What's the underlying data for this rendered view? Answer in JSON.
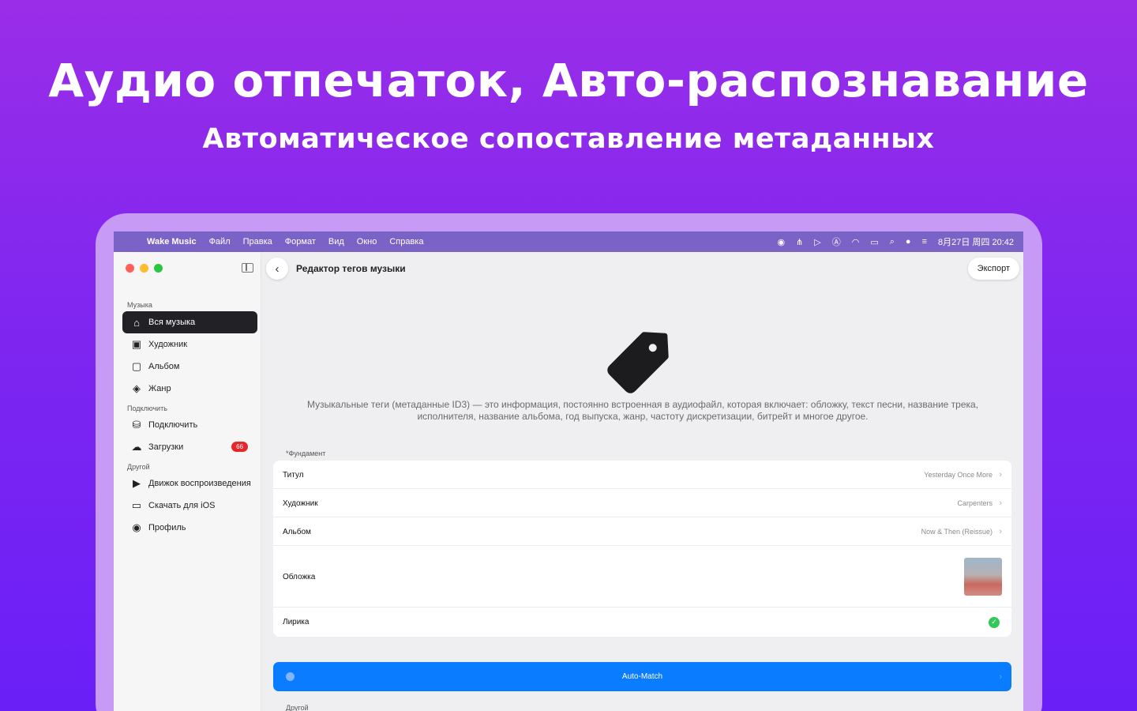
{
  "hero": {
    "title": "Аудио отпечаток, Авто-распознавание",
    "subtitle": "Автоматическое сопоставление метаданных"
  },
  "menubar": {
    "app_name": "Wake Music",
    "menus": [
      "Файл",
      "Правка",
      "Формат",
      "Вид",
      "Окно",
      "Справка"
    ],
    "clock": "8月27日 周四  20:42"
  },
  "sidebar": {
    "sections": [
      {
        "label": "Музыка"
      },
      {
        "label": "Подключить"
      },
      {
        "label": "Другой"
      }
    ],
    "items": [
      {
        "label": "Вся музыка",
        "icon": "home-music-icon",
        "active": true
      },
      {
        "label": "Художник",
        "icon": "artist-icon"
      },
      {
        "label": "Альбом",
        "icon": "album-icon"
      },
      {
        "label": "Жанр",
        "icon": "genre-layers-icon"
      },
      {
        "label": "Подключить",
        "icon": "drive-icon"
      },
      {
        "label": "Загрузки",
        "icon": "cloud-download-icon",
        "badge": "66"
      },
      {
        "label": "Движок воспроизведения",
        "icon": "play-engine-icon"
      },
      {
        "label": "Скачать для iOS",
        "icon": "devices-icon"
      },
      {
        "label": "Профиль",
        "icon": "profile-icon"
      }
    ]
  },
  "main": {
    "title": "Редактор тегов музыки",
    "export_label": "Экспорт",
    "description": "Музыкальные теги (метаданные ID3) — это информация, постоянно встроенная в аудиофайл, которая включает: обложку, текст песни, название трека, исполнителя, название альбома, год выпуска, жанр, частоту дискретизации, битрейт и многое другое.",
    "group_basic": "*Фундамент",
    "fields": [
      {
        "label": "Титул",
        "value": "Yesterday Once More"
      },
      {
        "label": "Художник",
        "value": "Carpenters"
      },
      {
        "label": "Альбом",
        "value": "Now & Then (Reissue)"
      },
      {
        "label": "Обложка",
        "value": ""
      },
      {
        "label": "Лирика",
        "value": ""
      }
    ],
    "auto_match_label": "Auto-Match",
    "group_other": "Другой"
  },
  "colors": {
    "accent": "#0a7cff",
    "badge": "#e5272b",
    "success": "#34c759",
    "background_gradient_top": "#9a2de8",
    "background_gradient_bottom": "#6a1ff7"
  }
}
